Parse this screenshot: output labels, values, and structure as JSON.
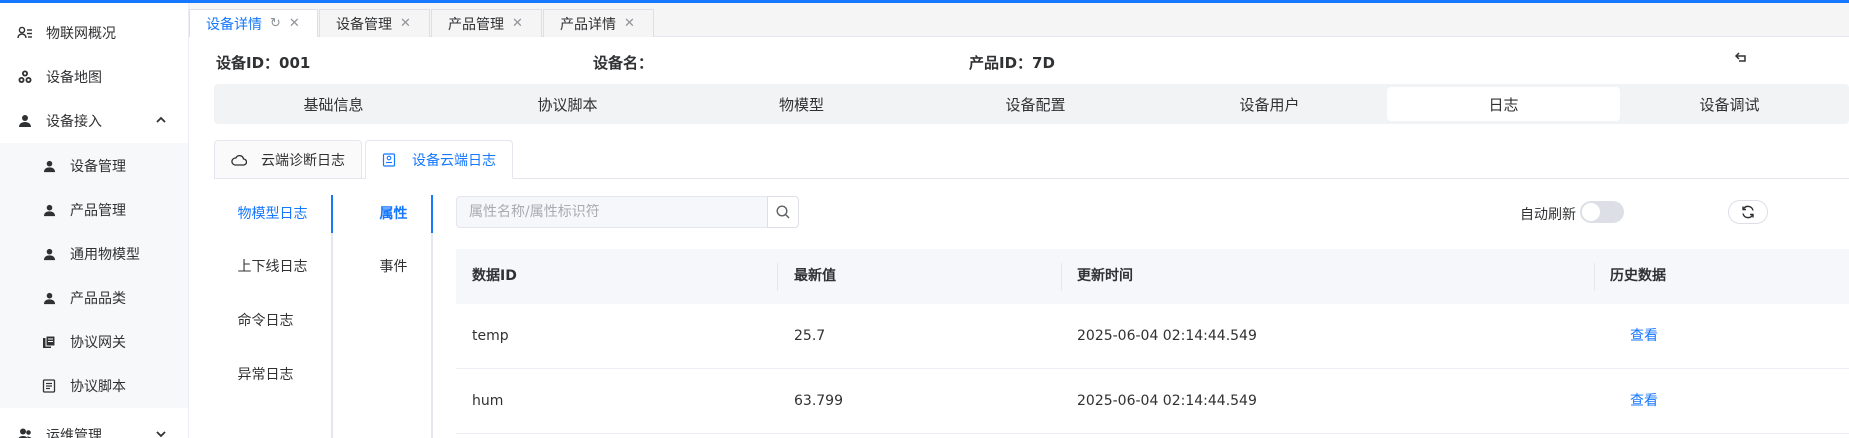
{
  "sidebar": {
    "items": [
      {
        "label": "物联网概况",
        "icon": "users-icon"
      },
      {
        "label": "设备地图",
        "icon": "cubes-icon"
      },
      {
        "label": "设备接入",
        "icon": "user-icon",
        "expanded": true
      },
      {
        "label": "运维管理",
        "icon": "user-group-icon",
        "expanded": false
      }
    ],
    "sub_items": [
      {
        "label": "设备管理",
        "icon": "user-icon"
      },
      {
        "label": "产品管理",
        "icon": "user-icon"
      },
      {
        "label": "通用物模型",
        "icon": "user-icon"
      },
      {
        "label": "产品品类",
        "icon": "user-icon"
      },
      {
        "label": "协议网关",
        "icon": "docs-icon"
      },
      {
        "label": "协议脚本",
        "icon": "file-icon"
      }
    ]
  },
  "page_tabs": [
    {
      "label": "设备详情",
      "active": true
    },
    {
      "label": "设备管理",
      "active": false
    },
    {
      "label": "产品管理",
      "active": false
    },
    {
      "label": "产品详情",
      "active": false
    }
  ],
  "device_info": {
    "device_id": "设备ID：001",
    "device_name": "设备名：",
    "product_id": "产品ID：7D"
  },
  "section_tabs": [
    "基础信息",
    "协议脚本",
    "物模型",
    "设备配置",
    "设备用户",
    "日志",
    "设备调试"
  ],
  "active_section": "日志",
  "log_tabs": [
    {
      "label": "云端诊断日志",
      "icon": "cloud-icon"
    },
    {
      "label": "设备云端日志",
      "icon": "device-log-icon"
    }
  ],
  "log_categories": [
    "物模型日志",
    "上下线日志",
    "命令日志",
    "异常日志"
  ],
  "model_sub_tabs": [
    "属性",
    "事件"
  ],
  "search": {
    "placeholder": "属性名称/属性标识符",
    "value": ""
  },
  "auto_refresh": {
    "label": "自动刷新",
    "on": false
  },
  "table": {
    "headers": [
      "数据ID",
      "最新值",
      "更新时间",
      "历史数据"
    ],
    "rows": [
      {
        "id": "temp",
        "value": "25.7",
        "time": "2025-06-04 02:14:44.549",
        "action": "查看"
      },
      {
        "id": "hum",
        "value": "63.799",
        "time": "2025-06-04 02:14:44.549",
        "action": "查看"
      }
    ]
  },
  "colors": {
    "accent": "#1677ff",
    "text": "#303133",
    "muted": "#909399"
  }
}
